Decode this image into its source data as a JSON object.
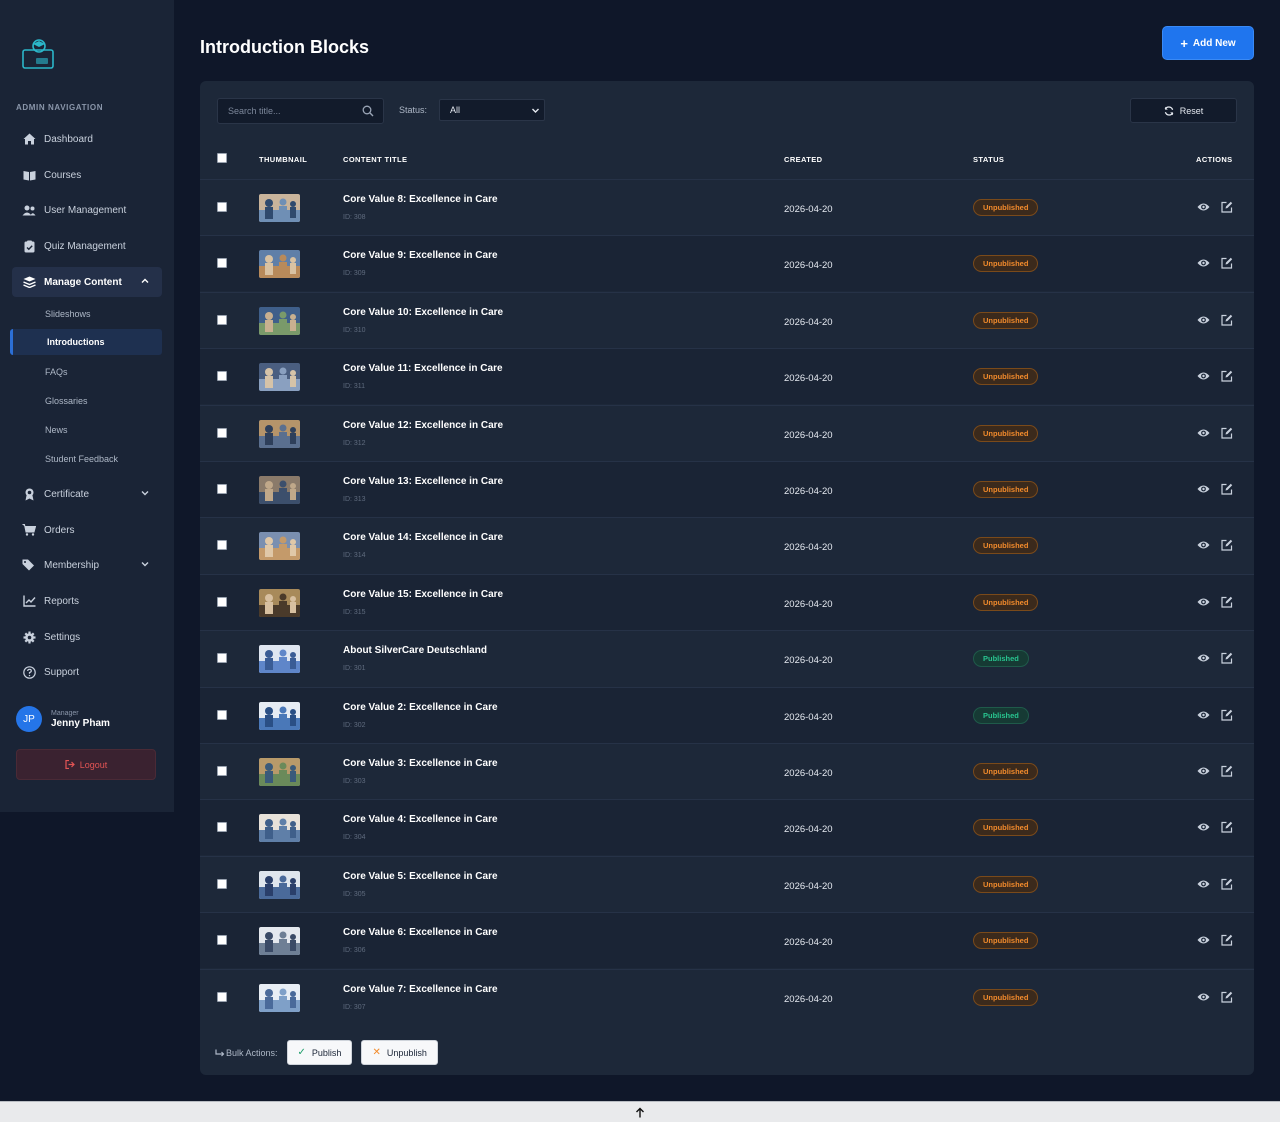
{
  "sidebar": {
    "heading": "ADMIN NAVIGATION",
    "items": [
      {
        "label": "Dashboard",
        "icon": "home-icon"
      },
      {
        "label": "Courses",
        "icon": "book-icon"
      },
      {
        "label": "User Management",
        "icon": "users-icon"
      },
      {
        "label": "Quiz Management",
        "icon": "clipboard-check-icon"
      },
      {
        "label": "Manage Content",
        "icon": "layers-icon"
      },
      {
        "label": "Certificate",
        "icon": "award-icon"
      },
      {
        "label": "Orders",
        "icon": "cart-icon"
      },
      {
        "label": "Membership",
        "icon": "tags-icon"
      },
      {
        "label": "Reports",
        "icon": "line-chart-icon"
      },
      {
        "label": "Settings",
        "icon": "gear-icon"
      },
      {
        "label": "Support",
        "icon": "question-circle-icon"
      }
    ],
    "sub_items": [
      "Slideshows",
      "Introductions",
      "FAQs",
      "Glossaries",
      "News",
      "Student Feedback"
    ],
    "user": {
      "initials": "JP",
      "role": "Manager",
      "name": "Jenny Pham"
    },
    "logout_label": "Logout"
  },
  "header": {
    "title": "Introduction Blocks",
    "add_new_label": "Add New"
  },
  "filters": {
    "search_placeholder": "Search title...",
    "status_label": "Status:",
    "status_value": "All",
    "reset_label": "Reset"
  },
  "table": {
    "columns": [
      "THUMBNAIL",
      "CONTENT TITLE",
      "CREATED",
      "STATUS",
      "ACTIONS"
    ],
    "rows": [
      {
        "title": "Core Value 8: Excellence in Care",
        "id": "ID: 308",
        "created": "2026-04-20",
        "status": "Unpublished"
      },
      {
        "title": "Core Value 9: Excellence in Care",
        "id": "ID: 309",
        "created": "2026-04-20",
        "status": "Unpublished"
      },
      {
        "title": "Core Value 10: Excellence in Care",
        "id": "ID: 310",
        "created": "2026-04-20",
        "status": "Unpublished"
      },
      {
        "title": "Core Value 11: Excellence in Care",
        "id": "ID: 311",
        "created": "2026-04-20",
        "status": "Unpublished"
      },
      {
        "title": "Core Value 12: Excellence in Care",
        "id": "ID: 312",
        "created": "2026-04-20",
        "status": "Unpublished"
      },
      {
        "title": "Core Value 13: Excellence in Care",
        "id": "ID: 313",
        "created": "2026-04-20",
        "status": "Unpublished"
      },
      {
        "title": "Core Value 14: Excellence in Care",
        "id": "ID: 314",
        "created": "2026-04-20",
        "status": "Unpublished"
      },
      {
        "title": "Core Value 15: Excellence in Care",
        "id": "ID: 315",
        "created": "2026-04-20",
        "status": "Unpublished"
      },
      {
        "title": "About SilverCare Deutschland",
        "id": "ID: 301",
        "created": "2026-04-20",
        "status": "Published"
      },
      {
        "title": "Core Value 2: Excellence in Care",
        "id": "ID: 302",
        "created": "2026-04-20",
        "status": "Published"
      },
      {
        "title": "Core Value 3: Excellence in Care",
        "id": "ID: 303",
        "created": "2026-04-20",
        "status": "Unpublished"
      },
      {
        "title": "Core Value 4: Excellence in Care",
        "id": "ID: 304",
        "created": "2026-04-20",
        "status": "Unpublished"
      },
      {
        "title": "Core Value 5: Excellence in Care",
        "id": "ID: 305",
        "created": "2026-04-20",
        "status": "Unpublished"
      },
      {
        "title": "Core Value 6: Excellence in Care",
        "id": "ID: 306",
        "created": "2026-04-20",
        "status": "Unpublished"
      },
      {
        "title": "Core Value 7: Excellence in Care",
        "id": "ID: 307",
        "created": "2026-04-20",
        "status": "Unpublished"
      }
    ]
  },
  "bulk": {
    "label": "Bulk Actions:",
    "publish_label": "Publish",
    "unpublish_label": "Unpublish"
  },
  "colors": {
    "accent": "#1f75ee",
    "unpublished": "#f28b2c",
    "published": "#28c48f",
    "danger": "#e35454"
  }
}
